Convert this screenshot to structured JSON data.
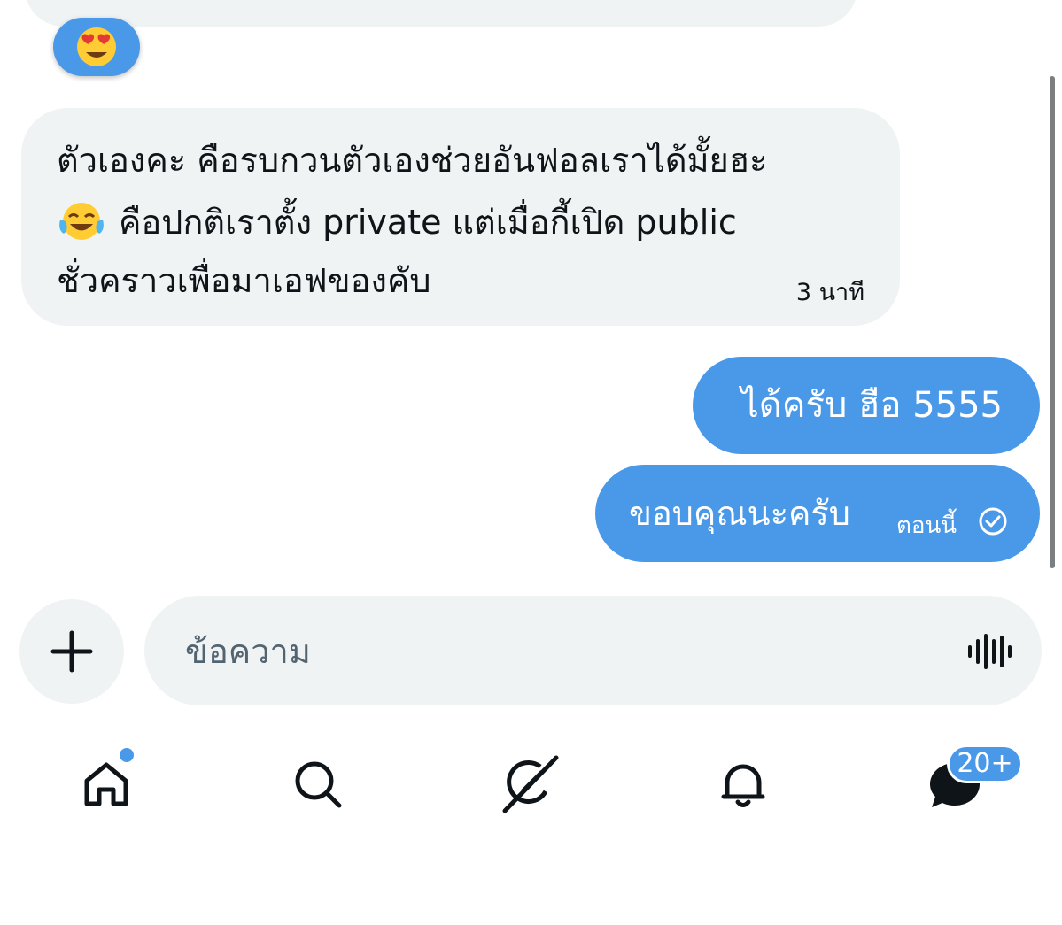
{
  "thread": {
    "reaction_emoji": "heart-eyes-emoji",
    "incoming": {
      "line1": "ตัวเองคะ คือรบกวนตัวเองช่วยอันฟอลเราได้มั้ยฮะ",
      "line2_emoji": "tears-of-joy-emoji",
      "line2": "คือปกติเราตั้ง private แต่เมื่อกี้เปิด public",
      "line3": "ชั่วคราวเพื่อมาเอฟของคับ",
      "time": "3 นาที"
    },
    "outgoing": [
      {
        "text": "ได้ครับ ฮือ 5555"
      },
      {
        "text": "ขอบคุณนะครับ",
        "time": "ตอนนี้",
        "status_icon": "read-check-icon"
      }
    ]
  },
  "composer": {
    "placeholder": "ข้อความ",
    "add_icon": "plus-icon",
    "voice_icon": "voice-waveform-icon"
  },
  "nav": {
    "items": [
      {
        "icon": "home-icon",
        "has_dot": true
      },
      {
        "icon": "search-icon"
      },
      {
        "icon": "grok-icon"
      },
      {
        "icon": "bell-icon"
      },
      {
        "icon": "messages-icon",
        "badge": "20+"
      }
    ]
  },
  "colors": {
    "accent": "#4a99e9",
    "bubble_in": "#eff3f4",
    "text": "#0f1419",
    "placeholder": "#536471"
  }
}
